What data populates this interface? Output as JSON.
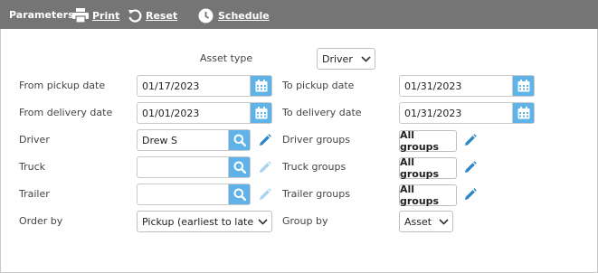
{
  "toolbar": {
    "title": "Parameters",
    "print_label": "Print",
    "reset_label": "Reset",
    "schedule_label": "Schedule"
  },
  "asset_type": {
    "label": "Asset type",
    "value": "Driver"
  },
  "from_pickup": {
    "label": "From pickup date",
    "value": "01/17/2023"
  },
  "to_pickup": {
    "label": "To pickup date",
    "value": "01/31/2023"
  },
  "from_delivery": {
    "label": "From delivery date",
    "value": "01/01/2023"
  },
  "to_delivery": {
    "label": "To delivery date",
    "value": "01/31/2023"
  },
  "driver": {
    "label": "Driver",
    "value": "Drew S"
  },
  "driver_groups": {
    "label": "Driver groups",
    "button": "All groups"
  },
  "truck": {
    "label": "Truck",
    "value": ""
  },
  "truck_groups": {
    "label": "Truck groups",
    "button": "All groups"
  },
  "trailer": {
    "label": "Trailer",
    "value": ""
  },
  "trailer_groups": {
    "label": "Trailer groups",
    "button": "All groups"
  },
  "order_by": {
    "label": "Order by",
    "value": "Pickup (earliest to latest"
  },
  "group_by": {
    "label": "Group by",
    "value": "Asset"
  },
  "colors": {
    "toolbar_bg": "#757575",
    "accent_blue": "#5fb3e8",
    "pencil_active": "#2e86c9",
    "pencil_disabled": "#a8d2f0"
  }
}
